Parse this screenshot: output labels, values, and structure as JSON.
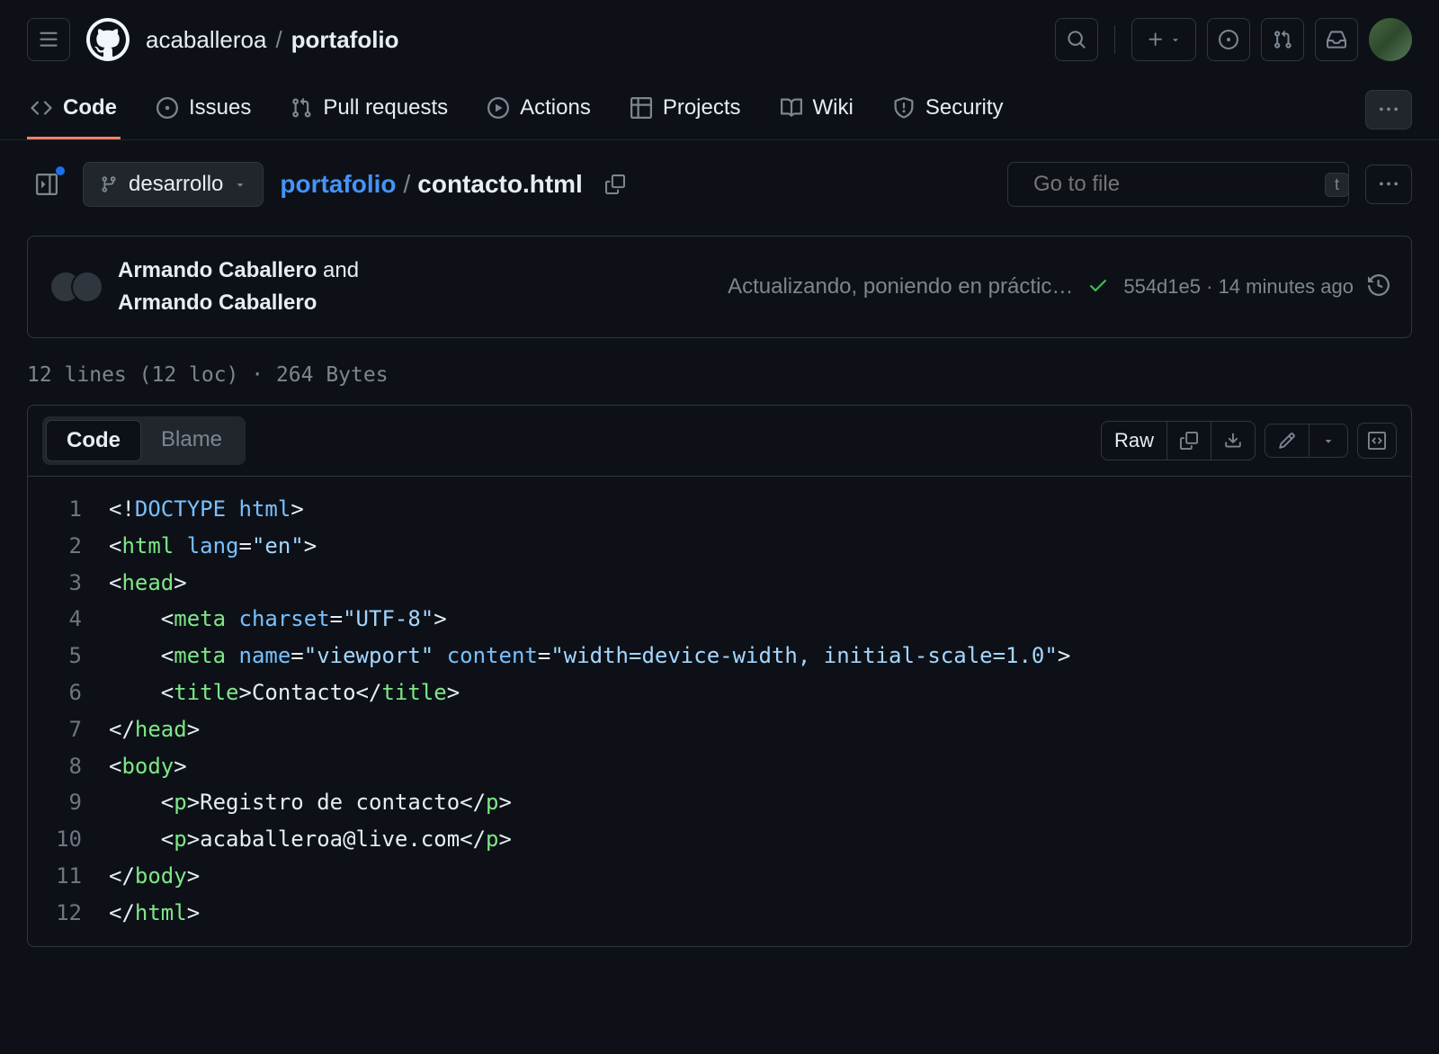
{
  "header": {
    "owner": "acaballeroa",
    "separator": "/",
    "repo": "portafolio"
  },
  "nav": {
    "code": "Code",
    "issues": "Issues",
    "pull_requests": "Pull requests",
    "actions": "Actions",
    "projects": "Projects",
    "wiki": "Wiki",
    "security": "Security"
  },
  "file": {
    "branch": "desarrollo",
    "repo_link": "portafolio",
    "separator": "/",
    "filename": "contacto.html",
    "search_placeholder": "Go to file",
    "search_kbd": "t"
  },
  "commit": {
    "author1": "Armando Caballero",
    "and": " and ",
    "author2": "Armando Caballero",
    "message": "Actualizando, poniendo en práctic…",
    "sha": "554d1e5",
    "dot": " · ",
    "time": "14 minutes ago"
  },
  "stats": "12 lines (12 loc) · 264 Bytes",
  "toolbar": {
    "code": "Code",
    "blame": "Blame",
    "raw": "Raw"
  },
  "code_lines": [
    {
      "n": "1",
      "html": "<span class='pl-kos'>&lt;!</span><span class='pl-c1'>DOCTYPE</span> <span class='pl-c1'>html</span><span class='pl-kos'>&gt;</span>"
    },
    {
      "n": "2",
      "html": "<span class='pl-kos'>&lt;</span><span class='pl-ent'>html</span> <span class='pl-c1'>lang</span>=<span class='pl-s'>\"en\"</span><span class='pl-kos'>&gt;</span>"
    },
    {
      "n": "3",
      "html": "<span class='pl-kos'>&lt;</span><span class='pl-ent'>head</span><span class='pl-kos'>&gt;</span>"
    },
    {
      "n": "4",
      "html": "    <span class='pl-kos'>&lt;</span><span class='pl-ent'>meta</span> <span class='pl-c1'>charset</span>=<span class='pl-s'>\"UTF-8\"</span><span class='pl-kos'>&gt;</span>"
    },
    {
      "n": "5",
      "html": "    <span class='pl-kos'>&lt;</span><span class='pl-ent'>meta</span> <span class='pl-c1'>name</span>=<span class='pl-s'>\"viewport\"</span> <span class='pl-c1'>content</span>=<span class='pl-s'>\"width=device-width, initial-scale=1.0\"</span><span class='pl-kos'>&gt;</span>"
    },
    {
      "n": "6",
      "html": "    <span class='pl-kos'>&lt;</span><span class='pl-ent'>title</span><span class='pl-kos'>&gt;</span>Contacto<span class='pl-kos'>&lt;/</span><span class='pl-ent'>title</span><span class='pl-kos'>&gt;</span>"
    },
    {
      "n": "7",
      "html": "<span class='pl-kos'>&lt;/</span><span class='pl-ent'>head</span><span class='pl-kos'>&gt;</span>"
    },
    {
      "n": "8",
      "html": "<span class='pl-kos'>&lt;</span><span class='pl-ent'>body</span><span class='pl-kos'>&gt;</span>"
    },
    {
      "n": "9",
      "html": "    <span class='pl-kos'>&lt;</span><span class='pl-ent'>p</span><span class='pl-kos'>&gt;</span>Registro de contacto<span class='pl-kos'>&lt;/</span><span class='pl-ent'>p</span><span class='pl-kos'>&gt;</span>"
    },
    {
      "n": "10",
      "html": "    <span class='pl-kos'>&lt;</span><span class='pl-ent'>p</span><span class='pl-kos'>&gt;</span>acaballeroa@live.com<span class='pl-kos'>&lt;/</span><span class='pl-ent'>p</span><span class='pl-kos'>&gt;</span>"
    },
    {
      "n": "11",
      "html": "<span class='pl-kos'>&lt;/</span><span class='pl-ent'>body</span><span class='pl-kos'>&gt;</span>"
    },
    {
      "n": "12",
      "html": "<span class='pl-kos'>&lt;/</span><span class='pl-ent'>html</span><span class='pl-kos'>&gt;</span>"
    }
  ]
}
